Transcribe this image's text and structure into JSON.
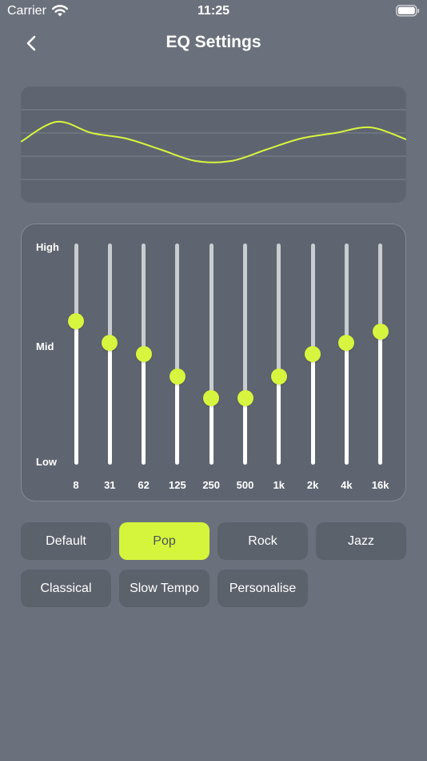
{
  "status_bar": {
    "carrier": "Carrier",
    "time": "11:25"
  },
  "header": {
    "title": "EQ Settings"
  },
  "eq": {
    "level_labels": {
      "high": "High",
      "mid": "Mid",
      "low": "Low"
    },
    "bands": [
      {
        "label": "8",
        "level": 0.65
      },
      {
        "label": "31",
        "level": 0.55
      },
      {
        "label": "62",
        "level": 0.5
      },
      {
        "label": "125",
        "level": 0.4
      },
      {
        "label": "250",
        "level": 0.3
      },
      {
        "label": "500",
        "level": 0.3
      },
      {
        "label": "1k",
        "level": 0.4
      },
      {
        "label": "2k",
        "level": 0.5
      },
      {
        "label": "4k",
        "level": 0.55
      },
      {
        "label": "16k",
        "level": 0.6
      }
    ]
  },
  "presets": [
    {
      "label": "Default",
      "active": false
    },
    {
      "label": "Pop",
      "active": true
    },
    {
      "label": "Rock",
      "active": false
    },
    {
      "label": "Jazz",
      "active": false
    },
    {
      "label": "Classical",
      "active": false
    },
    {
      "label": "Slow Tempo",
      "active": false
    },
    {
      "label": "Personalise",
      "active": false
    }
  ],
  "colors": {
    "background": "#6b717c",
    "panel": "#5f6570",
    "accent": "#d4f53c",
    "curve": "#d7f53e"
  }
}
